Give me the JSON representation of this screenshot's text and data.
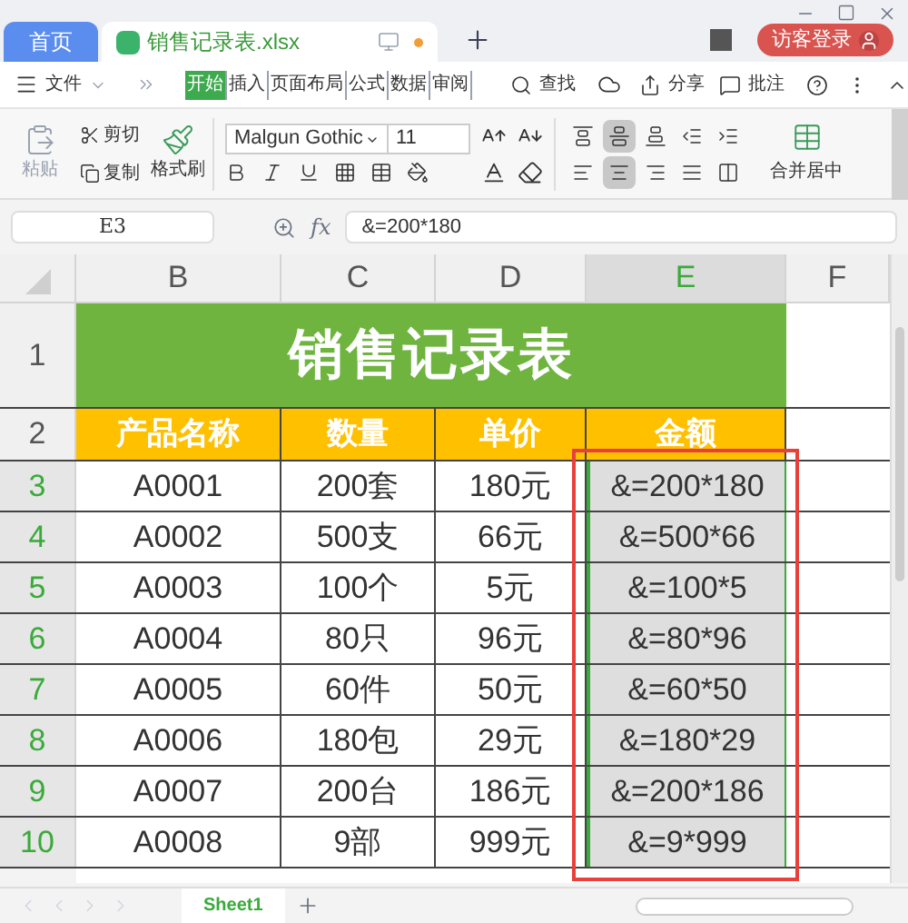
{
  "title_bar": {
    "tabs": [
      {
        "label": "首页",
        "selected": false
      },
      {
        "label": "销售记录表.xlsx",
        "selected": true
      }
    ],
    "login_button": "访客登录"
  },
  "menu_bar": {
    "file_menu": "文件",
    "ribbon_tabs": [
      {
        "label": "开始",
        "selected": true
      },
      {
        "label": "插入",
        "selected": false
      },
      {
        "label": "页面布局",
        "selected": false
      },
      {
        "label": "公式",
        "selected": false
      },
      {
        "label": "数据",
        "selected": false
      },
      {
        "label": "审阅",
        "selected": false
      }
    ],
    "search": "查找",
    "share": "分享",
    "comment": "批注"
  },
  "toolbar": {
    "paste": "粘贴",
    "cut": "剪切",
    "copy": "复制",
    "format_painter": "格式刷",
    "font": "Malgun Gothic",
    "font_size": "11",
    "merge": "合并居中",
    "align_buttons": [
      {
        "kind": "top",
        "selected": false
      },
      {
        "kind": "middle",
        "selected": true
      },
      {
        "kind": "bottom",
        "selected": false
      },
      {
        "kind": "outdent",
        "selected": false
      },
      {
        "kind": "indent",
        "selected": false
      },
      {
        "kind": "left",
        "selected": false
      },
      {
        "kind": "center",
        "selected": true
      },
      {
        "kind": "right",
        "selected": false
      },
      {
        "kind": "justify",
        "selected": false
      },
      {
        "kind": "distribute",
        "selected": false
      }
    ]
  },
  "formula_bar": {
    "cell_ref": "E3",
    "fx": "fx",
    "formula": "&=200*180"
  },
  "columns": [
    {
      "label": "B",
      "selected": false
    },
    {
      "label": "C",
      "selected": false
    },
    {
      "label": "D",
      "selected": false
    },
    {
      "label": "E",
      "selected": true
    },
    {
      "label": "F",
      "selected": false
    }
  ],
  "title_row": {
    "number": "1",
    "text": "销售记录表"
  },
  "header_row": {
    "number": "2",
    "cells": [
      "产品名称",
      "数量",
      "单价",
      "金额"
    ]
  },
  "rows": [
    {
      "number": "3",
      "selected": true,
      "cells": [
        "A0001",
        "200套",
        "180元",
        "&=200*180"
      ]
    },
    {
      "number": "4",
      "selected": true,
      "cells": [
        "A0002",
        "500支",
        "66元",
        "&=500*66"
      ]
    },
    {
      "number": "5",
      "selected": true,
      "cells": [
        "A0003",
        "100个",
        "5元",
        "&=100*5"
      ]
    },
    {
      "number": "6",
      "selected": true,
      "cells": [
        "A0004",
        "80只",
        "96元",
        "&=80*96"
      ]
    },
    {
      "number": "7",
      "selected": true,
      "cells": [
        "A0005",
        "60件",
        "50元",
        "&=60*50"
      ]
    },
    {
      "number": "8",
      "selected": true,
      "cells": [
        "A0006",
        "180包",
        "29元",
        "&=180*29"
      ]
    },
    {
      "number": "9",
      "selected": true,
      "cells": [
        "A0007",
        "200台",
        "186元",
        "&=200*186"
      ]
    },
    {
      "number": "10",
      "selected": true,
      "cells": [
        "A0008",
        "9部",
        "999元",
        "&=9*999"
      ]
    }
  ],
  "sheet_tabs": [
    {
      "label": "Sheet1",
      "selected": true
    }
  ]
}
